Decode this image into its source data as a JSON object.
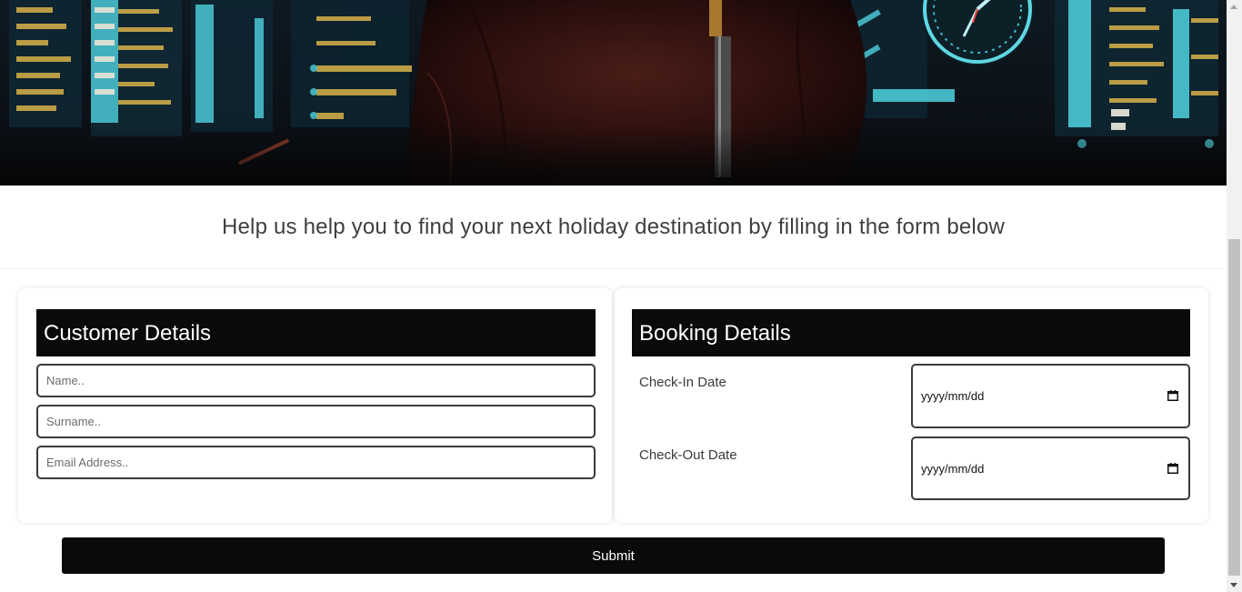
{
  "intro": {
    "text": "Help us help you to find your next holiday destination by filling in the form below"
  },
  "customer": {
    "title": "Customer Details",
    "name_placeholder": "Name..",
    "surname_placeholder": "Surname..",
    "email_placeholder": "Email Address.."
  },
  "booking": {
    "title": "Booking Details",
    "checkin_label": "Check-In Date",
    "checkin_value": "yyyy/mm/dd",
    "checkout_label": "Check-Out Date",
    "checkout_value": "yyyy/mm/dd"
  },
  "submit": {
    "label": "Submit"
  },
  "colors": {
    "header_bg": "#0a0a0a",
    "button_bg": "#0a0a0a",
    "input_border": "#3a3a3a",
    "intro_text": "#3f3f3f"
  },
  "icons": {
    "calendar": "calendar-icon",
    "scroll_up": "scroll-up-arrow-icon",
    "scroll_down": "scroll-down-arrow-icon"
  }
}
